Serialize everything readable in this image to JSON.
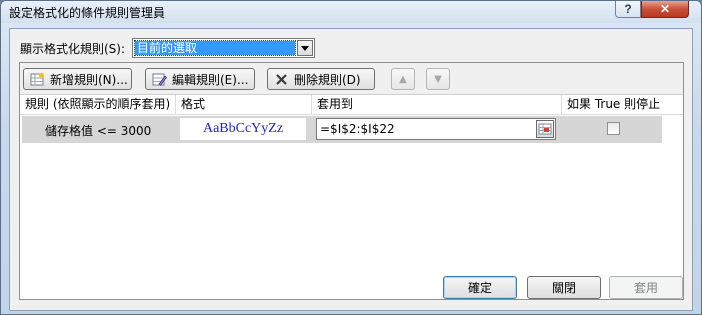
{
  "window": {
    "title": "設定格式化的條件規則管理員",
    "help_label": "?",
    "close_label": "✕"
  },
  "scope": {
    "label": "顯示格式化規則(S):",
    "selected": "目前的選取"
  },
  "toolbar": {
    "new_rule": "新增規則(N)...",
    "edit_rule": "編輯規則(E)...",
    "delete_rule": "刪除規則(D)",
    "move_up": "▲",
    "move_down": "▼"
  },
  "table": {
    "headers": [
      "規則 (依照顯示的順序套用)",
      "格式",
      "套用到",
      "如果 True 則停止"
    ],
    "rows": [
      {
        "rule": "儲存格值 <= 3000",
        "format_preview": "AaBbCcYyZz",
        "applies_to": "=$I$2:$I$22",
        "stop_if_true": false
      }
    ]
  },
  "buttons": {
    "ok": "確定",
    "close": "關閉",
    "apply": "套用"
  },
  "colors": {
    "selection": "#3399ff",
    "preview_text": "#2020cc",
    "close_button": "#c8503a"
  }
}
